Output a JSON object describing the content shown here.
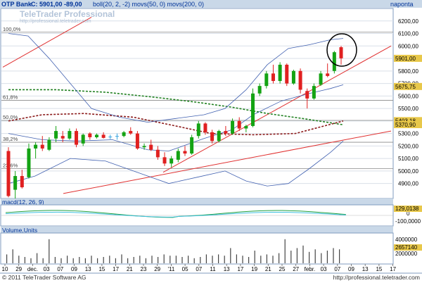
{
  "colors": {
    "header_bg": "#c9d8e8",
    "header_text": "#003399",
    "info_text": "#1b4fa0",
    "grid": "#d9dfe8",
    "up": "#14a314",
    "down": "#e02020",
    "neutral": "#3aa6e0",
    "trend": "#e03030",
    "boll": "#4060b0",
    "mov50": "#208020",
    "mov200": "#8b1a1a",
    "fib": "#888888",
    "label_bg": "#e8c84a",
    "panel_sep": "#7f9bbf"
  },
  "header": {
    "title": "OTP Bank",
    "quote": "C: 5901,00 -89,00",
    "indicators": "boll(20, 2, -2)  movs(50, 0)  movs(200, 0)",
    "period": "naponta"
  },
  "watermark": {
    "brand": "TeleTrader Professional",
    "url": "http://professional.teletrader.com"
  },
  "chart_data": [
    {
      "type": "candlestick",
      "title": "OTP Bank",
      "ylim": [
        4780,
        6300
      ],
      "y_ticks": [
        "6200,00",
        "6100,00",
        "6000,00",
        "5900,00",
        "5800,00",
        "5700,00",
        "5600,00",
        "5500,00",
        "5400,00",
        "5300,00",
        "5200,00",
        "5100,00",
        "5000,00",
        "4900,00"
      ],
      "fib_levels": [
        {
          "label": "100,0%",
          "value": 6110
        },
        {
          "label": "61,8%",
          "value": 5565
        },
        {
          "label": "50,0%",
          "value": 5405
        },
        {
          "label": "38,2%",
          "value": 5230
        },
        {
          "label": "23,6%",
          "value": 5020
        }
      ],
      "price_labels": [
        {
          "text": "5901,00",
          "value": 5901
        },
        {
          "text": "5675,75",
          "value": 5676
        },
        {
          "text": "5403,18",
          "value": 5403
        },
        {
          "text": "5370,90",
          "value": 5371
        }
      ],
      "candles": [
        [
          5160,
          5190,
          4790,
          4800
        ],
        [
          4850,
          5000,
          4780,
          4960
        ],
        [
          4960,
          5010,
          4860,
          4870
        ],
        [
          4950,
          5220,
          4940,
          5180
        ],
        [
          5180,
          5230,
          5100,
          5210
        ],
        [
          5210,
          5280,
          5160,
          5180
        ],
        [
          5170,
          5270,
          5160,
          5250
        ],
        [
          5260,
          5360,
          5230,
          5320
        ],
        [
          5280,
          5320,
          5230,
          5260
        ],
        [
          5260,
          5340,
          5250,
          5320
        ],
        [
          5320,
          5340,
          5190,
          5210
        ],
        [
          5220,
          5300,
          5200,
          5290
        ],
        [
          5300,
          5310,
          5250,
          5270
        ],
        [
          5270,
          5300,
          5260,
          5290
        ],
        [
          5290,
          5310,
          5260,
          5265
        ],
        [
          5270,
          5290,
          5255,
          5275
        ],
        [
          5280,
          5300,
          5250,
          5280
        ],
        [
          5280,
          5320,
          5270,
          5310
        ],
        [
          5320,
          5350,
          5290,
          5300
        ],
        [
          5300,
          5320,
          5170,
          5180
        ],
        [
          5190,
          5220,
          5170,
          5200
        ],
        [
          5210,
          5250,
          5160,
          5170
        ],
        [
          5170,
          5200,
          5090,
          5110
        ],
        [
          5110,
          5150,
          5040,
          5060
        ],
        [
          5060,
          5120,
          5030,
          5100
        ],
        [
          5090,
          5180,
          5070,
          5160
        ],
        [
          5160,
          5200,
          5120,
          5140
        ],
        [
          5140,
          5290,
          5130,
          5270
        ],
        [
          5280,
          5400,
          5260,
          5380
        ],
        [
          5380,
          5390,
          5290,
          5310
        ],
        [
          5310,
          5330,
          5220,
          5240
        ],
        [
          5240,
          5330,
          5230,
          5320
        ],
        [
          5320,
          5360,
          5280,
          5300
        ],
        [
          5300,
          5420,
          5290,
          5400
        ],
        [
          5400,
          5430,
          5320,
          5340
        ],
        [
          5340,
          5370,
          5310,
          5360
        ],
        [
          5360,
          5660,
          5350,
          5620
        ],
        [
          5620,
          5700,
          5600,
          5680
        ],
        [
          5680,
          5800,
          5660,
          5780
        ],
        [
          5780,
          5850,
          5700,
          5720
        ],
        [
          5720,
          5870,
          5700,
          5850
        ],
        [
          5850,
          5860,
          5680,
          5700
        ],
        [
          5700,
          5810,
          5690,
          5800
        ],
        [
          5800,
          5820,
          5620,
          5650
        ],
        [
          5640,
          5660,
          5500,
          5580
        ],
        [
          5580,
          5700,
          5570,
          5680
        ],
        [
          5690,
          5800,
          5680,
          5780
        ],
        [
          5780,
          5860,
          5750,
          5760
        ],
        [
          5800,
          5960,
          5780,
          5950
        ],
        [
          5990,
          6000,
          5850,
          5901
        ]
      ],
      "x_tick_labels": [
        "10",
        "29",
        "dec.",
        "03",
        "07",
        "09",
        "13",
        "15",
        "17",
        "21",
        "23",
        "29",
        "'11",
        "05",
        "07",
        "11",
        "13",
        "17",
        "19",
        "21",
        "25",
        "27",
        "febr.",
        "03",
        "07",
        "09",
        "13",
        "15",
        "17"
      ]
    },
    {
      "type": "line",
      "title": "macd(12, 26, 9)",
      "value_label": "129,0138",
      "y_ticks": [
        "0",
        "-100,0000"
      ]
    },
    {
      "type": "bar",
      "title": "Volume,Units",
      "value_label": "2657140",
      "y_ticks": [
        "4000000",
        "2000000"
      ]
    }
  ],
  "footer": {
    "copyright": "© 2011 TeleTrader Software AG",
    "url": "http://professional.teletrader.com"
  }
}
